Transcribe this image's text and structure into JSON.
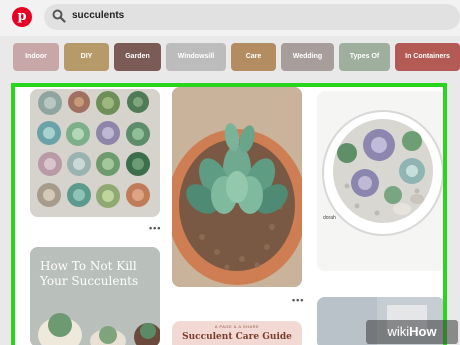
{
  "search": {
    "query": "succulents"
  },
  "chips": [
    {
      "label": "Indoor",
      "color": "#c7a7a7"
    },
    {
      "label": "DIY",
      "color": "#b69a6a"
    },
    {
      "label": "Garden",
      "color": "#7b5b55"
    },
    {
      "label": "Windowsill",
      "color": "#bcbcbc"
    },
    {
      "label": "Care",
      "color": "#b38c62"
    },
    {
      "label": "Wedding",
      "color": "#a79e9c"
    },
    {
      "label": "Types Of",
      "color": "#9faf9e"
    },
    {
      "label": "In Containers",
      "color": "#b35a54"
    }
  ],
  "pins": {
    "how_to": {
      "title": "How To Not Kill Your Succulents"
    },
    "care_guide": {
      "kicker": "A PAGE & A SHARE",
      "title": "Succulent Care Guide"
    },
    "dorah_label": "dorah"
  },
  "more_label": "•••",
  "watermark": {
    "prefix": "wiki",
    "suffix": "How"
  },
  "colors": {
    "highlight": "#2ad61d",
    "brand": "#e60023"
  }
}
